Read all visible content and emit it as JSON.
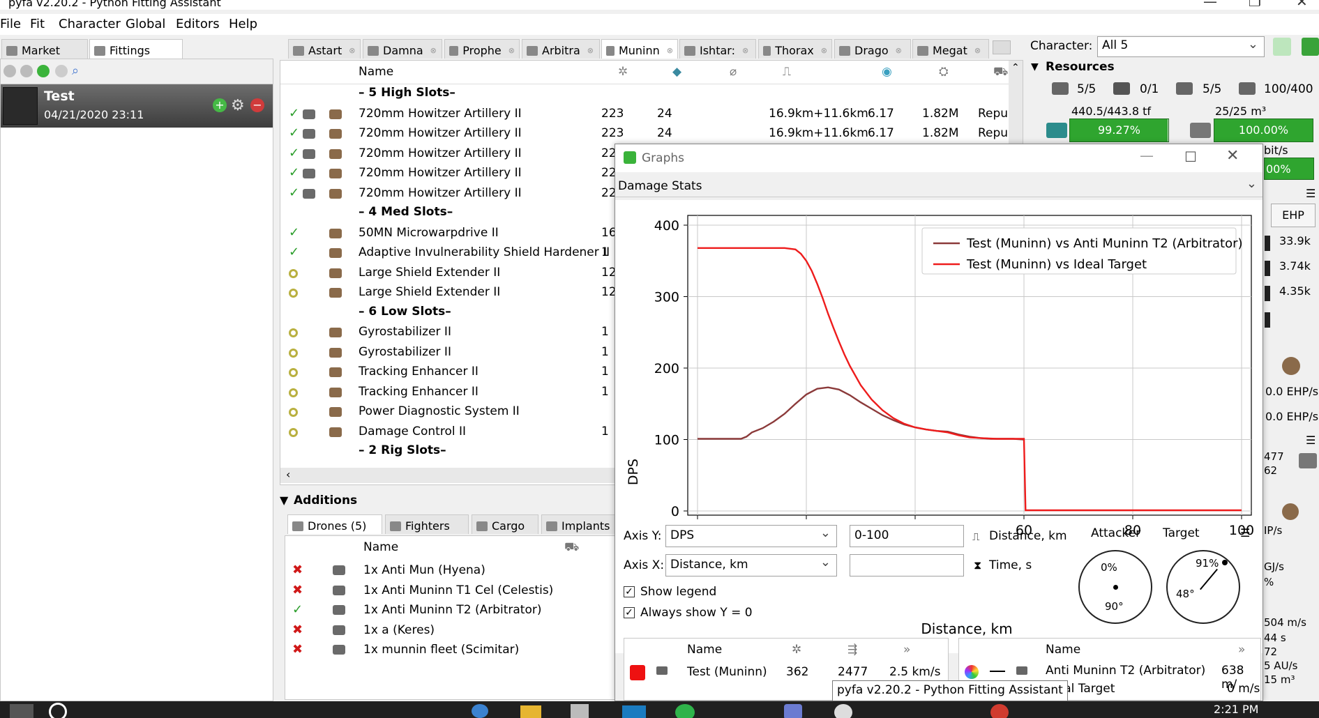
{
  "window": {
    "title": "pyfa v2.20.2 - Python Fitting Assistant"
  },
  "menu": [
    "File",
    "Fit",
    "Character",
    "Global",
    "Editors",
    "Help"
  ],
  "left_tabs": [
    "Market",
    "Fittings"
  ],
  "fit": {
    "name": "Test",
    "date": "04/21/2020 23:11"
  },
  "fit_tabs": [
    "Astart",
    "Damna",
    "Prophe",
    "Arbitra",
    "Muninn",
    "Ishtar:",
    "Thorax",
    "Drago",
    "Megat"
  ],
  "modules": {
    "name_header": "Name",
    "high_header": "– 5 High Slots–",
    "high": [
      {
        "name": "720mm Howitzer Artillery II",
        "c1": "223",
        "c2": "24",
        "c3": "16.9km+11.6km",
        "c4": "6.17",
        "c5": "1.82M",
        "c6": "Repu"
      },
      {
        "name": "720mm Howitzer Artillery II",
        "c1": "223",
        "c2": "24",
        "c3": "16.9km+11.6km",
        "c4": "6.17",
        "c5": "1.82M",
        "c6": "Repu"
      },
      {
        "name": "720mm Howitzer Artillery II",
        "c1": "22"
      },
      {
        "name": "720mm Howitzer Artillery II",
        "c1": "22"
      },
      {
        "name": "720mm Howitzer Artillery II",
        "c1": "22"
      }
    ],
    "med_header": "– 4 Med Slots–",
    "med": [
      {
        "name": "50MN Microwarpdrive II",
        "c1": "16",
        "state": "active"
      },
      {
        "name": "Adaptive Invulnerability Shield Hardener II",
        "c1": "1",
        "state": "active"
      },
      {
        "name": "Large Shield Extender II",
        "c1": "12",
        "state": "online"
      },
      {
        "name": "Large Shield Extender II",
        "c1": "12",
        "state": "online"
      }
    ],
    "low_header": "– 6 Low Slots–",
    "low": [
      {
        "name": "Gyrostabilizer II",
        "c1": "1"
      },
      {
        "name": "Gyrostabilizer II",
        "c1": "1"
      },
      {
        "name": "Tracking Enhancer II",
        "c1": "1"
      },
      {
        "name": "Tracking Enhancer II",
        "c1": "1"
      },
      {
        "name": "Power Diagnostic System II",
        "c1": ""
      },
      {
        "name": "Damage Control II",
        "c1": "1"
      }
    ],
    "rig_header": "– 2 Rig Slots–"
  },
  "additions": {
    "title": "Additions",
    "tabs": [
      "Drones (5)",
      "Fighters",
      "Cargo",
      "Implants"
    ],
    "name_header": "Name",
    "drones": [
      {
        "name": "1x Anti Mun (Hyena)",
        "active": false
      },
      {
        "name": "1x Anti Muninn T1 Cel (Celestis)",
        "active": false
      },
      {
        "name": "1x Anti Muninn T2 (Arbitrator)",
        "active": true
      },
      {
        "name": "1x a (Keres)",
        "active": false
      },
      {
        "name": "1x munnin fleet (Scimitar)",
        "active": false
      }
    ]
  },
  "right_panel": {
    "character_label": "Character:",
    "character_value": "All 5",
    "resources_label": "Resources",
    "slots": [
      "5/5",
      "0/1",
      "5/5",
      "100/400"
    ],
    "cpu_text": "440.5/443.8 tf",
    "cpu_percent": "99.27%",
    "cpu_fraction": 0.9927,
    "calib_text": "25/25 m³",
    "calib_percent": "100.00%",
    "calib_fraction": 1.0,
    "partial_1": "bit/s",
    "partial_2": "00%",
    "ehp_label": "EHP",
    "ehp_values": [
      "33.9k",
      "3.74k",
      "4.35k"
    ],
    "ehps_values": [
      "0.0 EHP/s",
      "0.0 EHP/s"
    ],
    "misc": [
      "477",
      "62",
      "IP/s",
      "GJ/s",
      "%",
      "504 m/s",
      "44 s",
      "72",
      "5 AU/s",
      "15 m³"
    ]
  },
  "graph_window": {
    "title": "Graphs",
    "graph_select": "Damage Stats",
    "axis_y_label": "Axis Y:",
    "axis_y_value": "DPS",
    "axis_x_label": "Axis X:",
    "axis_x_value": "Distance, km",
    "range_value": "0-100",
    "distance_label": "Distance, km",
    "time_label": "Time, s",
    "show_legend": "Show legend",
    "always_show_y0": "Always show Y = 0",
    "attacker_label": "Attacker",
    "target_label": "Target",
    "attacker_dial": {
      "pct": "0%",
      "angle": "90°"
    },
    "target_dial": {
      "pct": "91%",
      "angle": "48°"
    },
    "attackers": {
      "name_header": "Name",
      "rows": [
        {
          "name": "Test (Muninn)",
          "v1": "362",
          "v2": "2477",
          "v3": "2.5 km/s"
        }
      ]
    },
    "targets": {
      "name_header": "Name",
      "rows": [
        {
          "name": "Anti Muninn T2 (Arbitrator)",
          "v1": "638 m/"
        },
        {
          "name": "Ideal Target",
          "v1": "0 m/s"
        }
      ]
    }
  },
  "tooltip": "pyfa v2.20.2 - Python Fitting Assistant",
  "clock": "2:21 PM",
  "chart_data": {
    "type": "line",
    "xlabel": "Distance, km",
    "ylabel": "DPS",
    "xlim": [
      0,
      100
    ],
    "ylim": [
      0,
      400
    ],
    "xticks": [
      0,
      20,
      40,
      60,
      80,
      100
    ],
    "yticks": [
      0,
      100,
      200,
      300,
      400
    ],
    "grid": true,
    "legend_position": "top-right",
    "series": [
      {
        "name": "Test (Muninn) vs Anti Muninn T2 (Arbitrator)",
        "color": "#8b3a3a",
        "x": [
          0,
          5,
          8,
          9,
          10,
          12,
          14,
          16,
          18,
          20,
          22,
          24,
          26,
          28,
          30,
          32,
          34,
          36,
          38,
          40,
          42,
          44,
          46,
          48,
          50,
          52,
          54,
          56,
          58,
          60
        ],
        "y": [
          101,
          101,
          101,
          104,
          110,
          116,
          125,
          136,
          150,
          163,
          171,
          173,
          170,
          162,
          152,
          143,
          134,
          127,
          121,
          117,
          114,
          112,
          111,
          107,
          104,
          102,
          101,
          101,
          101,
          100
        ]
      },
      {
        "name": "Test (Muninn) vs Ideal Target",
        "color": "#ee1c1c",
        "x": [
          0,
          4,
          8,
          12,
          16,
          18,
          19,
          20,
          21,
          22,
          23,
          24,
          25,
          26,
          27,
          28,
          30,
          32,
          34,
          36,
          38,
          40,
          42,
          44,
          46,
          48,
          50,
          52,
          55,
          58,
          60,
          60.3,
          62,
          70,
          80,
          90,
          100
        ],
        "y": [
          368,
          368,
          368,
          368,
          368,
          366,
          360,
          350,
          336,
          318,
          298,
          276,
          256,
          237,
          219,
          203,
          176,
          156,
          141,
          130,
          122,
          117,
          114,
          112,
          110,
          106,
          103,
          102,
          101,
          101,
          101,
          1,
          1,
          1,
          1,
          1,
          1
        ]
      }
    ]
  }
}
